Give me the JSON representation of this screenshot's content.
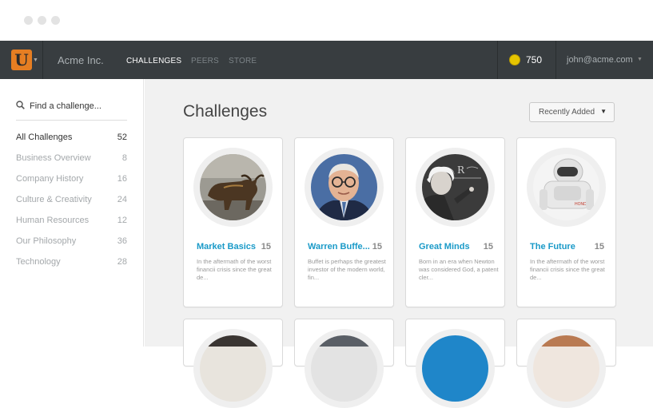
{
  "header": {
    "logo_letter": "U",
    "company": "Acme Inc.",
    "nav": [
      {
        "label": "CHALLENGES",
        "active": true
      },
      {
        "label": "PEERS",
        "active": false
      },
      {
        "label": "STORE",
        "active": false
      }
    ],
    "coins": "750",
    "user_email": "john@acme.com"
  },
  "sidebar": {
    "search_placeholder": "Find a challenge...",
    "categories": [
      {
        "label": "All Challenges",
        "count": "52",
        "active": true
      },
      {
        "label": "Business Overview",
        "count": "8",
        "active": false
      },
      {
        "label": "Company History",
        "count": "16",
        "active": false
      },
      {
        "label": "Culture & Creativity",
        "count": "24",
        "active": false
      },
      {
        "label": "Human Resources",
        "count": "12",
        "active": false
      },
      {
        "label": "Our Philosophy",
        "count": "36",
        "active": false
      },
      {
        "label": "Technology",
        "count": "28",
        "active": false
      }
    ]
  },
  "main": {
    "title": "Challenges",
    "sort_label": "Recently Added",
    "cards": [
      {
        "title": "Market Basics",
        "count": "15",
        "desc": "In the aftermath of the worst financii crisis since the great de...",
        "image": "bull-statue-photo"
      },
      {
        "title": "Warren Buffe...",
        "count": "15",
        "desc": "Buffet is perhaps the greatest investor of the modern world, fin...",
        "image": "warren-buffett-photo"
      },
      {
        "title": "Great Minds",
        "count": "15",
        "desc": "Born in an era when Newton was considered God, a patent cler...",
        "image": "einstein-chalkboard-photo"
      },
      {
        "title": "The Future",
        "count": "15",
        "desc": "In the aftermath of the worst financii crisis since the great de...",
        "image": "robot-photo"
      }
    ]
  },
  "colors": {
    "topbar": "#383d40",
    "accent_link": "#1a9ac8",
    "logo_orange": "#e67e22",
    "coin_gold": "#e5c400"
  }
}
